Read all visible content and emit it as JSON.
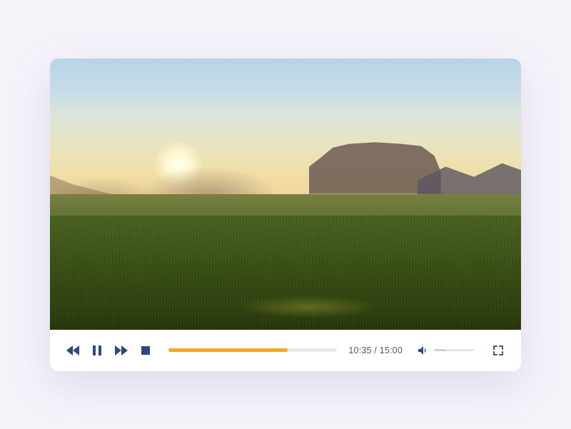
{
  "player": {
    "current_time": "10:35",
    "duration": "15:00",
    "time_display": "10:35 / 15:00",
    "progress_percent": 70.5,
    "volume_percent": 30,
    "colors": {
      "icon": "#2d4a7a",
      "progress_fill": "#f2a825",
      "progress_track": "#e8e8e8"
    },
    "icons": {
      "rewind": "rewind-icon",
      "pause": "pause-icon",
      "forward": "fast-forward-icon",
      "stop": "stop-icon",
      "volume": "volume-icon",
      "fullscreen": "fullscreen-icon"
    }
  }
}
